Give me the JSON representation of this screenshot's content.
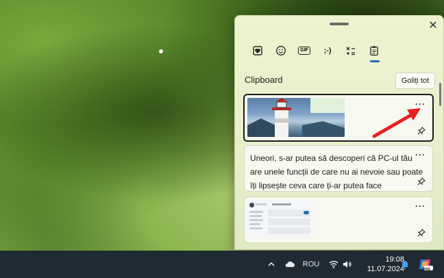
{
  "panel": {
    "close_icon": "close-icon",
    "tabs": [
      {
        "name": "emoji-heart-tab",
        "icon": "heart-icon"
      },
      {
        "name": "emoji-tab",
        "icon": "smiley-icon"
      },
      {
        "name": "gif-tab",
        "label": "GIF"
      },
      {
        "name": "kaomoji-tab",
        "label": ";-)"
      },
      {
        "name": "symbols-tab",
        "icon": "symbols-icon"
      },
      {
        "name": "clipboard-tab",
        "icon": "clipboard-icon",
        "active": true
      }
    ],
    "section_title": "Clipboard",
    "clear_all_label": "Goliți tot",
    "more_label": "···",
    "items": [
      {
        "type": "image",
        "description_icon": "lighthouse-image"
      },
      {
        "type": "text",
        "text": "Uneori, s-ar putea să descoperi că PC-ul tău are unele funcții de care nu ai nevoie sau poate îți lipsește ceva care ți-ar putea face"
      },
      {
        "type": "image",
        "description_icon": "settings-screenshot-image"
      }
    ],
    "accent_color": "#1a6fb8"
  },
  "taskbar": {
    "language": "ROU",
    "time": "19:08",
    "date": "11.07.2024",
    "copilot_badge": "PRE"
  },
  "annotation": {
    "color": "#e8201e"
  }
}
